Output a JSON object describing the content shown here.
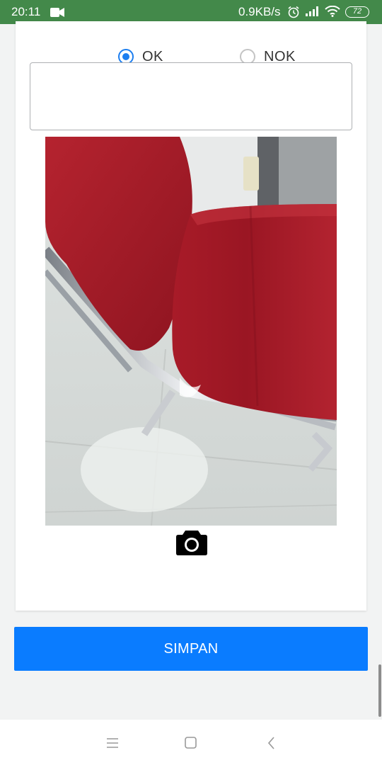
{
  "status_bar": {
    "time": "20:11",
    "network_speed": "0.9KB/s",
    "battery_level": "72",
    "icons": [
      "video-icon",
      "alarm-icon",
      "signal-icon",
      "wifi-icon",
      "battery-icon"
    ]
  },
  "form": {
    "radio_options": [
      {
        "label": "OK",
        "selected": true
      },
      {
        "label": "NOK",
        "selected": false
      }
    ],
    "note": {
      "value": "",
      "placeholder": ""
    },
    "photo": {
      "description": "photo of red chairs"
    },
    "camera_icon": "camera-icon"
  },
  "actions": {
    "save_label": "SIMPAN"
  },
  "nav_bar": {
    "icons": [
      "menu-icon",
      "home-icon",
      "back-icon"
    ]
  },
  "colors": {
    "status_bar": "#43894a",
    "accent": "#1c7ef0",
    "save_button": "#0a7cff"
  }
}
